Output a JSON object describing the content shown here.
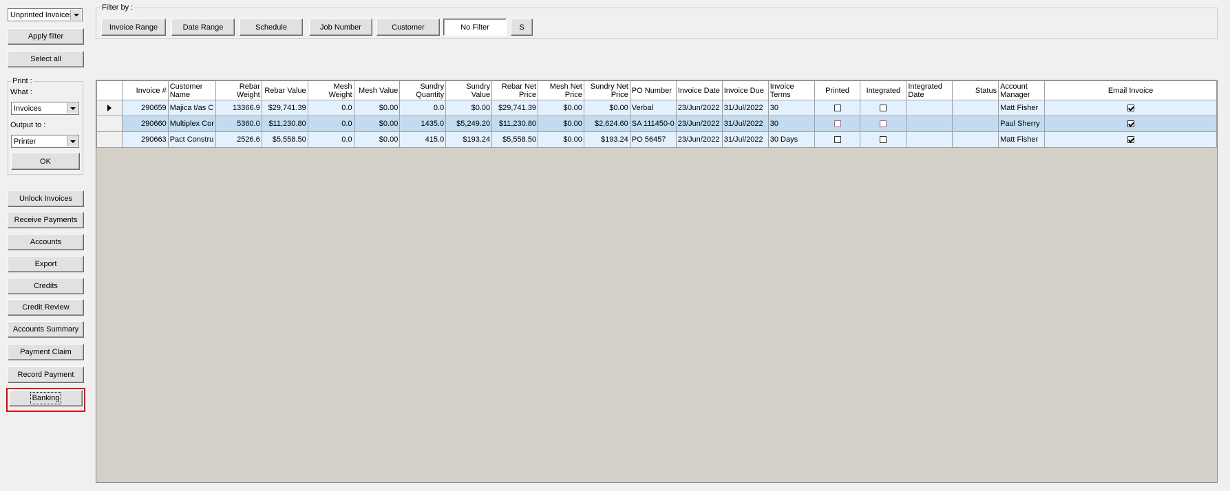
{
  "filter_select": {
    "value": "Unprinted Invoices"
  },
  "buttons_top": {
    "apply_filter": "Apply filter",
    "select_all": "Select all"
  },
  "print_group": {
    "title": "Print :",
    "what_label": "What :",
    "what_value": "Invoices",
    "output_label": "Output to :",
    "output_value": "Printer",
    "ok": "OK"
  },
  "side_buttons": {
    "unlock": "Unlock Invoices",
    "receive": "Receive Payments",
    "accounts": "Accounts",
    "export": "Export",
    "credits": "Credits",
    "credit_review": "Credit Review",
    "accounts_summary": "Accounts Summary",
    "payment_claim": "Payment Claim",
    "record_payment": "Record Payment",
    "banking": "Banking"
  },
  "filter_by": {
    "title": "Filter by :",
    "invoice_range": "Invoice Range",
    "date_range": "Date Range",
    "schedule": "Schedule",
    "job_number": "Job Number",
    "customer": "Customer",
    "no_filter": "No Filter",
    "s": "S"
  },
  "grid": {
    "headers": {
      "invoice": "Invoice #",
      "customer": "Customer Name",
      "rebar_weight": "Rebar Weight",
      "rebar_value": "Rebar Value",
      "mesh_weight": "Mesh Weight",
      "mesh_value": "Mesh Value",
      "sundry_qty": "Sundry Quantity",
      "sundry_value": "Sundry Value",
      "rebar_net": "Rebar Net Price",
      "mesh_net": "Mesh Net Price",
      "sundry_net": "Sundry Net Price",
      "po": "PO Number",
      "inv_date": "Invoice Date",
      "inv_due": "Invoice Due",
      "terms": "Invoice Terms",
      "printed": "Printed",
      "integrated": "Integrated",
      "int_date": "Integrated Date",
      "status": "Status",
      "manager": "Account Manager",
      "email": "Email Invoice"
    },
    "rows": [
      {
        "invoice": "290659",
        "customer": "Majica t/as C",
        "rebar_weight": "13366.9",
        "rebar_value": "$29,741.39",
        "mesh_weight": "0.0",
        "mesh_value": "$0.00",
        "sundry_qty": "0.0",
        "sundry_value": "$0.00",
        "rebar_net": "$29,741.39",
        "mesh_net": "$0.00",
        "sundry_net": "$0.00",
        "po": "Verbal",
        "inv_date": "23/Jun/2022",
        "inv_due": "31/Jul/2022",
        "terms": "30",
        "printed": false,
        "integrated": false,
        "int_date": "",
        "status": "",
        "manager": "Matt Fisher",
        "email": true
      },
      {
        "invoice": "290660",
        "customer": "Multiplex Cor",
        "rebar_weight": "5360.0",
        "rebar_value": "$11,230.80",
        "mesh_weight": "0.0",
        "mesh_value": "$0.00",
        "sundry_qty": "1435.0",
        "sundry_value": "$5,249.20",
        "rebar_net": "$11,230.80",
        "mesh_net": "$0.00",
        "sundry_net": "$2,624.60",
        "po": "SA 111450-0",
        "inv_date": "23/Jun/2022",
        "inv_due": "31/Jul/2022",
        "terms": "30",
        "printed": false,
        "integrated": false,
        "int_date": "",
        "status": "",
        "manager": "Paul Sherry",
        "email": true
      },
      {
        "invoice": "290663",
        "customer": "Pact Constru",
        "rebar_weight": "2526.6",
        "rebar_value": "$5,558.50",
        "mesh_weight": "0.0",
        "mesh_value": "$0.00",
        "sundry_qty": "415.0",
        "sundry_value": "$193.24",
        "rebar_net": "$5,558.50",
        "mesh_net": "$0.00",
        "sundry_net": "$193.24",
        "po": "PO 56457",
        "inv_date": "23/Jun/2022",
        "inv_due": "31/Jul/2022",
        "terms": "30 Days",
        "printed": false,
        "integrated": false,
        "int_date": "",
        "status": "",
        "manager": "Matt Fisher",
        "email": true
      }
    ]
  },
  "colors": {
    "highlight": "#e00000",
    "grid_bg": "#d4d0c8",
    "row": "#e3f0fd",
    "row_selected": "#c2dbf1"
  }
}
